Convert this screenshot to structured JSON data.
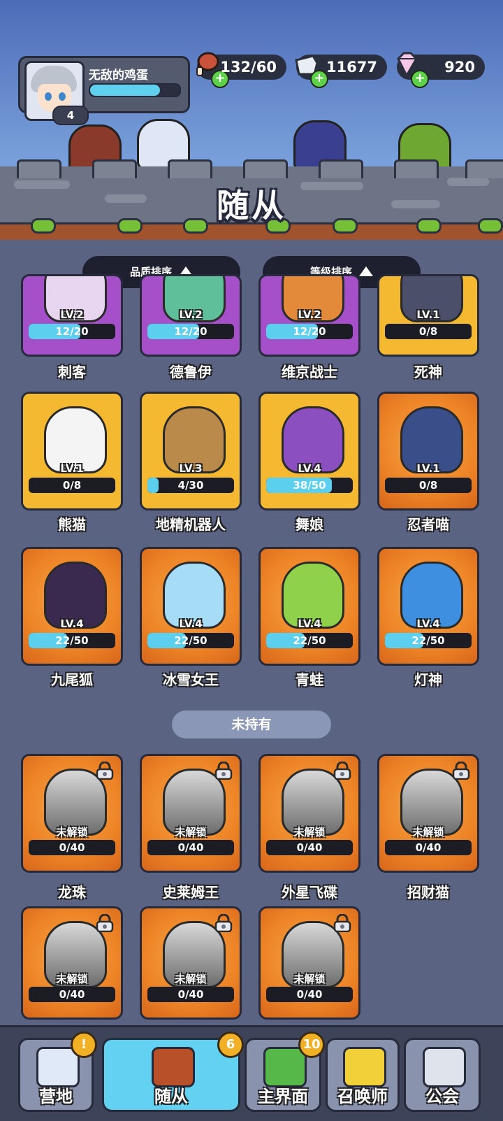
{
  "screen_title": "随从",
  "player": {
    "name": "无敌的鸡蛋",
    "level": "4",
    "xp_fraction": 0.78
  },
  "resources": [
    {
      "icon": "meat-icon",
      "value": "132/60"
    },
    {
      "icon": "fist-icon",
      "value": "11677"
    },
    {
      "icon": "diamond-icon",
      "value": "920"
    }
  ],
  "sort": {
    "quality_label": "品质排序",
    "level_label": "等级排序"
  },
  "owned": [
    {
      "name": "刺客",
      "level": "LV.2",
      "progress": "12/20",
      "fill": 0.6,
      "rarity": "purple",
      "art": "#e8d6f0"
    },
    {
      "name": "德鲁伊",
      "level": "LV.2",
      "progress": "12/20",
      "fill": 0.6,
      "rarity": "purple",
      "art": "#5fbf9a"
    },
    {
      "name": "维京战士",
      "level": "LV.2",
      "progress": "12/20",
      "fill": 0.6,
      "rarity": "purple",
      "art": "#e28a3a"
    },
    {
      "name": "死神",
      "level": "LV.1",
      "progress": "0/8",
      "fill": 0.0,
      "rarity": "gold",
      "art": "#4c4f6a"
    },
    {
      "name": "熊猫",
      "level": "LV.1",
      "progress": "0/8",
      "fill": 0.0,
      "rarity": "gold",
      "art": "#f4f4f4"
    },
    {
      "name": "地精机器人",
      "level": "LV.3",
      "progress": "4/30",
      "fill": 0.13,
      "rarity": "gold",
      "art": "#b98a4a"
    },
    {
      "name": "舞娘",
      "level": "LV.4",
      "progress": "38/50",
      "fill": 0.76,
      "rarity": "gold",
      "art": "#8b4fbf"
    },
    {
      "name": "忍者喵",
      "level": "LV.1",
      "progress": "0/8",
      "fill": 0.0,
      "rarity": "orange",
      "art": "#3a4f8a"
    },
    {
      "name": "九尾狐",
      "level": "LV.4",
      "progress": "22/50",
      "fill": 0.44,
      "rarity": "orange",
      "art": "#3b2a4f"
    },
    {
      "name": "冰雪女王",
      "level": "LV.4",
      "progress": "22/50",
      "fill": 0.44,
      "rarity": "orange",
      "art": "#a6dcf5"
    },
    {
      "name": "青蛙",
      "level": "LV.4",
      "progress": "22/50",
      "fill": 0.44,
      "rarity": "orange",
      "art": "#8fd14a"
    },
    {
      "name": "灯神",
      "level": "LV.4",
      "progress": "22/50",
      "fill": 0.44,
      "rarity": "orange",
      "art": "#3f8fe0"
    }
  ],
  "not_owned_label": "未持有",
  "locked": [
    {
      "name": "龙珠",
      "status": "未解锁",
      "progress": "0/40"
    },
    {
      "name": "史莱姆王",
      "status": "未解锁",
      "progress": "0/40"
    },
    {
      "name": "外星飞碟",
      "status": "未解锁",
      "progress": "0/40"
    },
    {
      "name": "招财猫",
      "status": "未解锁",
      "progress": "0/40"
    },
    {
      "name": "",
      "status": "未解锁",
      "progress": "0/40"
    },
    {
      "name": "",
      "status": "未解锁",
      "progress": "0/40"
    },
    {
      "name": "",
      "status": "未解锁",
      "progress": "0/40"
    }
  ],
  "nav": [
    {
      "label": "营地",
      "badge": "!",
      "active": false
    },
    {
      "label": "随从",
      "badge": "6",
      "active": true
    },
    {
      "label": "主界面",
      "badge": "10",
      "active": false
    },
    {
      "label": "召唤师",
      "badge": "",
      "active": false
    },
    {
      "label": "公会",
      "badge": "",
      "active": false
    }
  ],
  "colors": {
    "progress": "#5ccfee",
    "active_tab": "#62d1f2",
    "badge": "#f1b026"
  }
}
